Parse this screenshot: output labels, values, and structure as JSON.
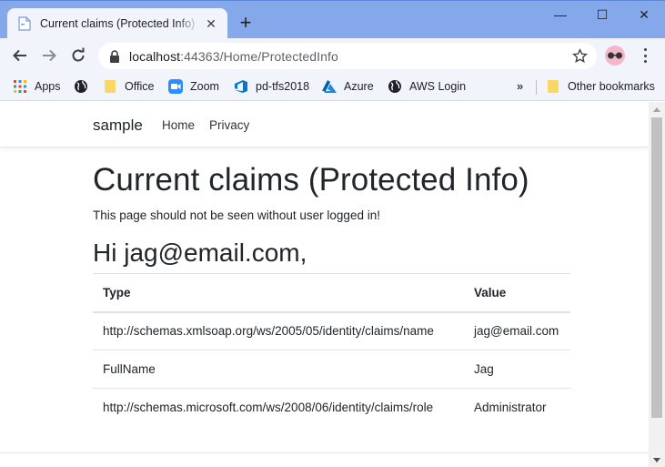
{
  "browser": {
    "tab_title": "Current claims (Protected Info) - s",
    "new_tab": "+",
    "window_minimize": "—",
    "window_maximize": "☐",
    "window_close": "✕",
    "url_host": "localhost",
    "url_rest": ":44363/Home/ProtectedInfo"
  },
  "bookmarks": {
    "items": [
      {
        "label": "Apps",
        "icon": "apps-grid-icon"
      },
      {
        "label": "",
        "icon": "globe-icon"
      },
      {
        "label": "Office",
        "icon": "folder-icon"
      },
      {
        "label": "Zoom",
        "icon": "zoom-icon"
      },
      {
        "label": "pd-tfs2018",
        "icon": "azure-devops-icon"
      },
      {
        "label": "Azure",
        "icon": "azure-icon"
      },
      {
        "label": "AWS Login",
        "icon": "globe-icon"
      }
    ],
    "more": "»",
    "other": "Other bookmarks"
  },
  "site": {
    "brand": "sample",
    "nav": [
      "Home",
      "Privacy"
    ]
  },
  "page": {
    "title": "Current claims (Protected Info)",
    "subtitle": "This page should not be seen without user logged in!",
    "greeting": "Hi jag@email.com,"
  },
  "table": {
    "headers": [
      "Type",
      "Value"
    ],
    "rows": [
      [
        "http://schemas.xmlsoap.org/ws/2005/05/identity/claims/name",
        "jag@email.com"
      ],
      [
        "FullName",
        "Jag"
      ],
      [
        "http://schemas.microsoft.com/ws/2008/06/identity/claims/role",
        "Administrator"
      ]
    ]
  },
  "colors": {
    "tabstrip": "#84a8e9",
    "toolbar": "#f1f4fb",
    "text": "#212529"
  }
}
